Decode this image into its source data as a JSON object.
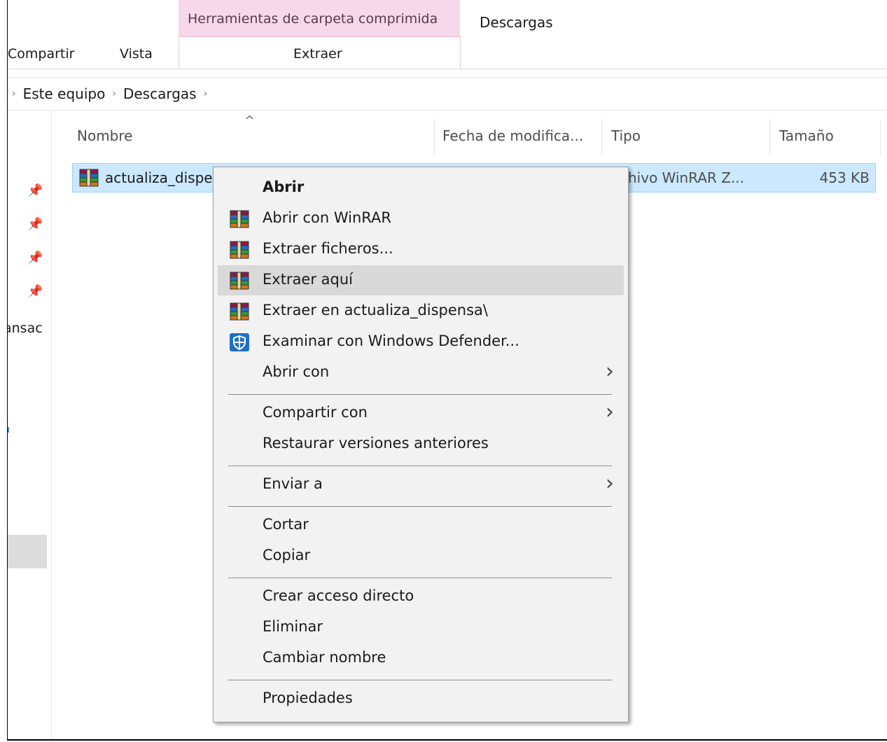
{
  "ribbon": {
    "context_label": "Herramientas de carpeta comprimida",
    "descargas_tab": "Descargas",
    "tabs": [
      "Compartir",
      "Vista"
    ],
    "extract_tab": "Extraer"
  },
  "breadcrumb": {
    "items": [
      "Este equipo",
      "Descargas"
    ]
  },
  "left_pane": {
    "partial_text": "ansac"
  },
  "columns": {
    "name": "Nombre",
    "date": "Fecha de modifica...",
    "type": "Tipo",
    "size": "Tamaño"
  },
  "file": {
    "name": "actualiza_dispe",
    "type": "chivo WinRAR Z...",
    "size": "453 KB"
  },
  "context_menu": {
    "items": [
      "Abrir",
      "Abrir con WinRAR",
      "Extraer ficheros...",
      "Extraer aquí",
      "Extraer en actualiza_dispensa\\",
      "Examinar con Windows Defender...",
      "Abrir con",
      "Compartir con",
      "Restaurar versiones anteriores",
      "Enviar a",
      "Cortar",
      "Copiar",
      "Crear acceso directo",
      "Eliminar",
      "Cambiar nombre",
      "Propiedades"
    ],
    "highlighted": "Extraer aquí"
  },
  "colors": {
    "selection": "#cce8ff",
    "context_tab": "#f7d7ea",
    "menu_bg": "#f2f2f2",
    "menu_hover": "#d9d9d9"
  }
}
